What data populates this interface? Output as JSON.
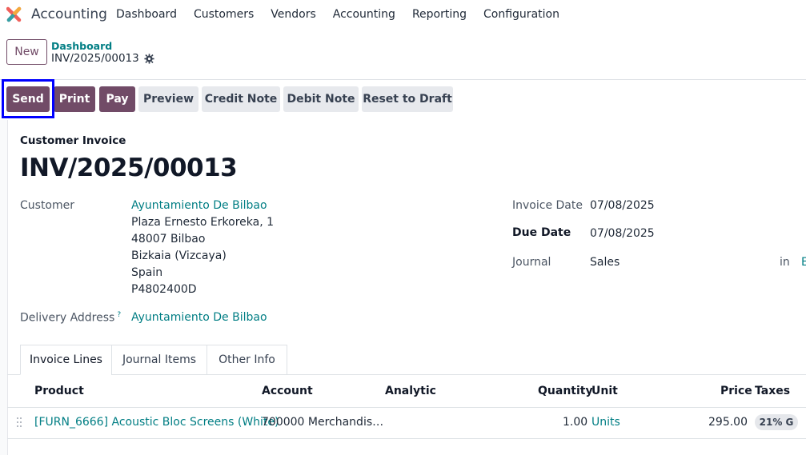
{
  "navbar": {
    "app_name": "Accounting",
    "menu": [
      "Dashboard",
      "Customers",
      "Vendors",
      "Accounting",
      "Reporting",
      "Configuration"
    ]
  },
  "control_panel": {
    "new_label": "New",
    "breadcrumb": "Dashboard",
    "record_name": "INV/2025/00013"
  },
  "actions": {
    "send": "Send",
    "print": "Print",
    "pay": "Pay",
    "preview": "Preview",
    "credit_note": "Credit Note",
    "debit_note": "Debit Note",
    "reset_to_draft": "Reset to Draft"
  },
  "invoice": {
    "type": "Customer Invoice",
    "number": "INV/2025/00013",
    "customer_label": "Customer",
    "customer_name": "Ayuntamiento De Bilbao",
    "address_lines": [
      "Plaza Ernesto Erkoreka, 1",
      "48007 Bilbao",
      "Bizkaia (Vizcaya)",
      "Spain",
      "P4802400D"
    ],
    "delivery_label": "Delivery Address",
    "delivery_help": "?",
    "delivery_value": "Ayuntamiento De Bilbao",
    "invoice_date_label": "Invoice Date",
    "invoice_date": "07/08/2025",
    "due_date_label": "Due Date",
    "due_date": "07/08/2025",
    "journal_label": "Journal",
    "journal": "Sales",
    "journal_in": "in",
    "journal_currency": "E"
  },
  "tabs": [
    "Invoice Lines",
    "Journal Items",
    "Other Info"
  ],
  "table": {
    "headers": {
      "product": "Product",
      "account": "Account",
      "analytic": "Analytic",
      "quantity": "Quantity",
      "unit": "Unit",
      "price": "Price",
      "taxes": "Taxes"
    },
    "rows": [
      {
        "product": "[FURN_6666] Acoustic Bloc Screens (White)",
        "account": "700000 Merchandis…",
        "analytic": "",
        "quantity": "1.00",
        "unit": "Units",
        "price": "295.00",
        "taxes": "21% G"
      }
    ]
  },
  "colors": {
    "primary": "#714b67",
    "link": "#017e84",
    "highlight": "#0000ff"
  }
}
